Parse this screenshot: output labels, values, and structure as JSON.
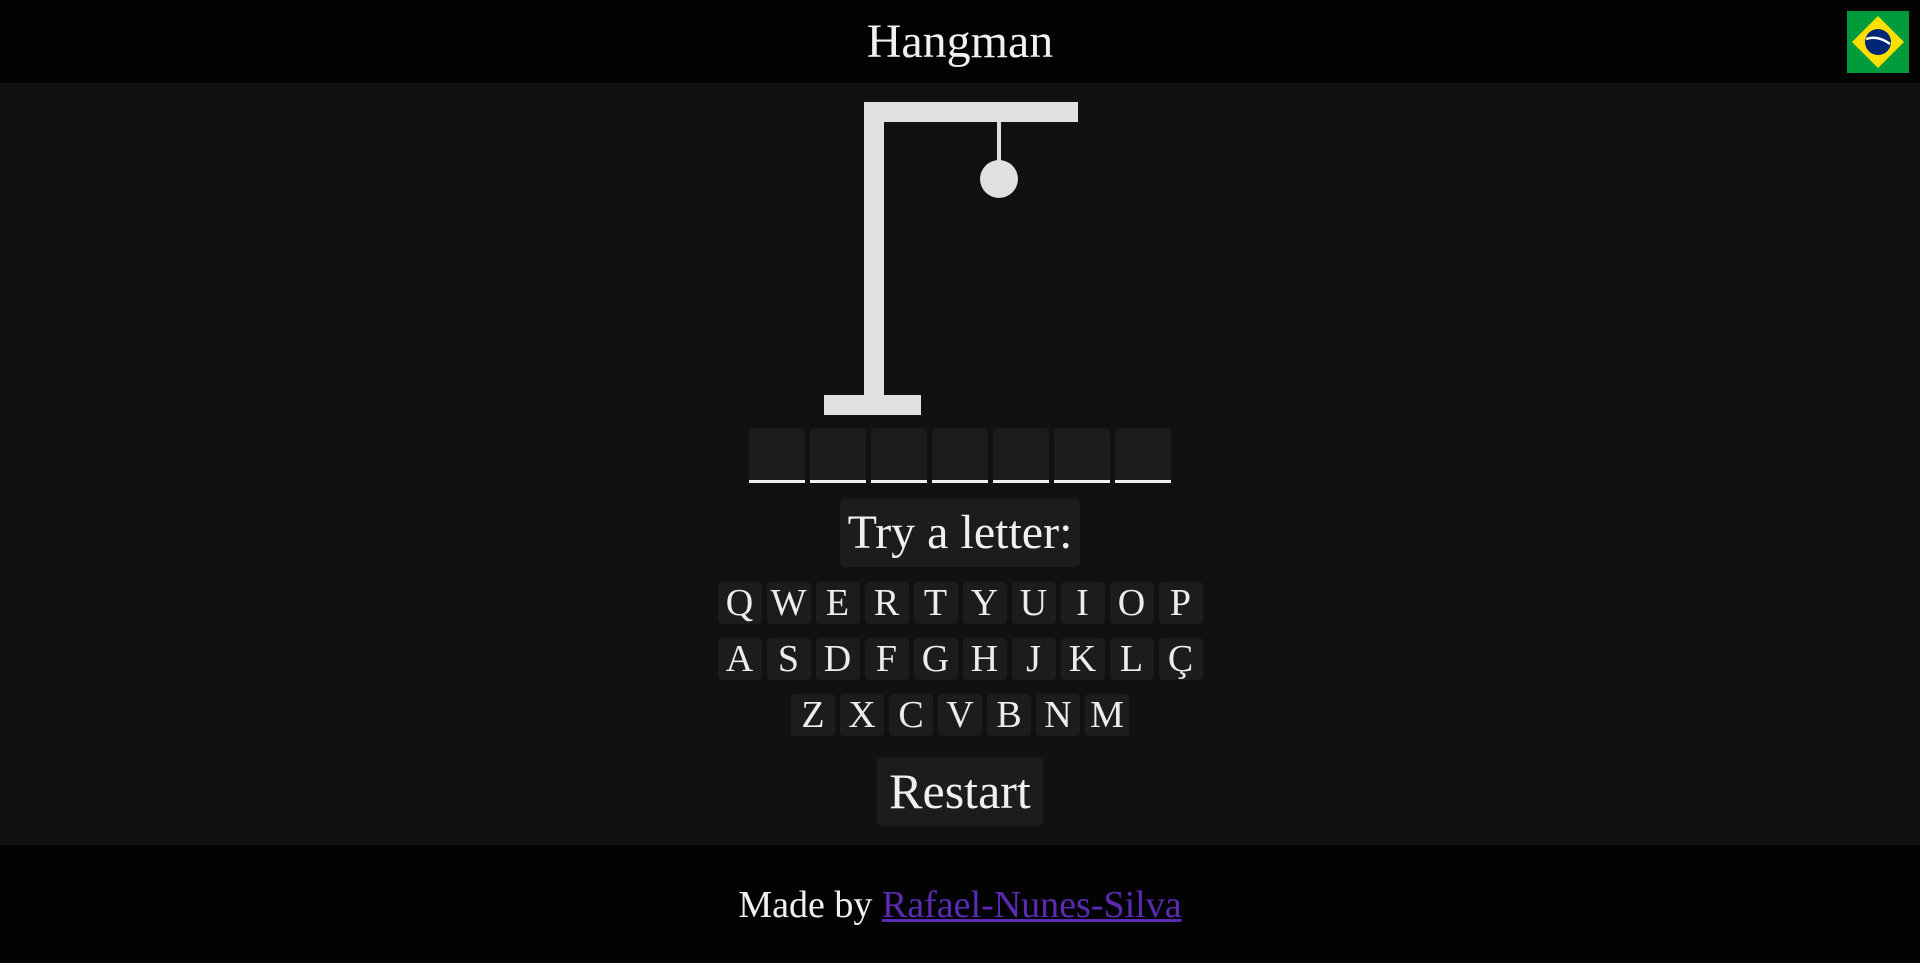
{
  "header": {
    "title": "Hangman",
    "language_flag_icon": "brazil-flag-icon",
    "colors": {
      "flag_green": "#009c3b",
      "flag_yellow": "#ffdf00",
      "flag_blue": "#002776"
    }
  },
  "game": {
    "wrong_guesses": 1,
    "word_slots": [
      "",
      "",
      "",
      "",
      "",
      "",
      ""
    ],
    "prompt": "Try a letter:",
    "keyboard": {
      "row1": [
        "Q",
        "W",
        "E",
        "R",
        "T",
        "Y",
        "U",
        "I",
        "O",
        "P"
      ],
      "row2": [
        "A",
        "S",
        "D",
        "F",
        "G",
        "H",
        "J",
        "K",
        "L",
        "Ç"
      ],
      "row3": [
        "Z",
        "X",
        "C",
        "V",
        "B",
        "N",
        "M"
      ]
    },
    "restart_label": "Restart"
  },
  "footer": {
    "prefix": "Made by",
    "author_link": "Rafael-Nunes-Silva",
    "link_color": "#5a2bb0"
  }
}
